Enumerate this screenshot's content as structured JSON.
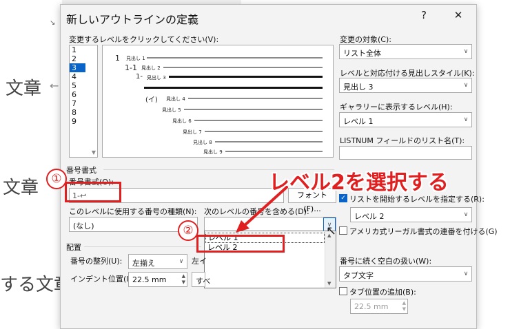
{
  "document": {
    "text_1": "文章",
    "text_2": "文章",
    "text_3": "する文章"
  },
  "dialog": {
    "title": "新しいアウトラインの定義",
    "help": "?",
    "close": "✕",
    "click_level_label": "変更するレベルをクリックしてください(V):",
    "levels": [
      "1",
      "2",
      "3",
      "4",
      "5",
      "6",
      "7",
      "8",
      "9"
    ],
    "selected_level": "3",
    "preview": {
      "lines": [
        {
          "prefix": "1",
          "label": "見出し 1"
        },
        {
          "prefix": "1-1",
          "label": "見出し 2"
        },
        {
          "prefix": "1-",
          "label": "見出し 3"
        },
        {
          "prefix": "(イ)",
          "label": "見出し 4"
        },
        {
          "prefix": "",
          "label": "見出し 5"
        },
        {
          "prefix": "",
          "label": "見出し 6"
        },
        {
          "prefix": "",
          "label": "見出し 7"
        },
        {
          "prefix": "",
          "label": "見出し 8"
        },
        {
          "prefix": "",
          "label": "見出し 9"
        }
      ]
    },
    "apply_to_label": "変更の対象(C):",
    "apply_to_value": "リスト全体",
    "link_style_label": "レベルと対応付ける見出しスタイル(K):",
    "link_style_value": "見出し 3",
    "gallery_level_label": "ギャラリーに表示するレベル(H):",
    "gallery_level_value": "レベル 1",
    "listnum_label": "LISTNUM フィールドのリスト名(T):",
    "listnum_value": "",
    "number_format_section": "番号書式",
    "number_format_label": "番号書式(O):",
    "number_format_value": "1-↩",
    "font_button": "フォント(F)...",
    "number_style_label": "このレベルに使用する番号の種類(N):",
    "number_style_value": "(なし)",
    "include_level_label": "次のレベルの番号を含める(D):",
    "include_level_value": "",
    "dropdown_options": [
      "レベル 1",
      "レベル 2"
    ],
    "restart_label": "リストを開始するレベルを指定する(R):",
    "restart_value": "レベル 2",
    "legal_label": "アメリカ式リーガル書式の連番を付ける(G)",
    "position_section": "配置",
    "alignment_label": "番号の整列(U):",
    "alignment_value": "左揃え",
    "align_at_partial": "左イ",
    "indent_label": "インデント位置(I):",
    "indent_value": "22.5 mm",
    "indent_partial": "すべ",
    "follow_label": "番号に続く空白の扱い(W):",
    "follow_value": "タブ文字",
    "tab_stop_label": "タブ位置の追加(B):",
    "tab_stop_value": "22.5 mm"
  },
  "annotations": {
    "badge_1": "①",
    "badge_2": "②",
    "callout": "レベル2を選択する",
    "accent_color": "#e02020"
  }
}
